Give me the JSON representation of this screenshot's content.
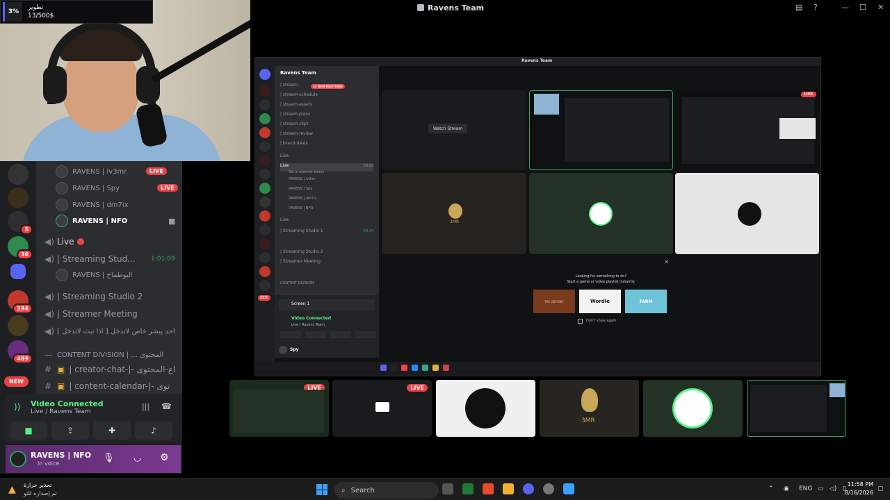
{
  "stream_goal": {
    "percent": "3%",
    "label": "تطوير",
    "progress": "13/500$"
  },
  "window": {
    "title": "Ravens Team"
  },
  "left_panel": {
    "voice_users_top": [
      {
        "name": "RAVENS | iv3mr",
        "live": "LIVE"
      },
      {
        "name": "RAVENS | Spy",
        "live": "LIVE"
      },
      {
        "name": "RAVENS | dm7ix"
      },
      {
        "name": "RAVENS | NFO"
      }
    ],
    "channel_live": "Live",
    "streaming_studio_1": "| Streaming Stud...",
    "studio_timer": "1:01:09",
    "studio_user": "RAVENS | البوطماح",
    "streaming_studio_2": "| Streaming Studio 2",
    "streamer_meeting": "| Streamer Meeting",
    "arabic_channel": "احد يبشر خاص لاتدخل [ اذا تبث لاتدخل ]",
    "category": "CONTENT DIVISION | ... المحتوى",
    "text_channels": [
      "| creator-chat-|- اع-المحتوى",
      "| content-calendar-|- توى"
    ],
    "server_badges": [
      "3",
      "36",
      "194",
      "489"
    ],
    "new_badge": "NEW"
  },
  "voice_connected": {
    "title": "Video Connected",
    "channel": "Live",
    "server": "/ Ravens Team"
  },
  "user_bar": {
    "name": "RAVENS | NFO",
    "status": "In voice"
  },
  "inner_discord": {
    "title": "Ravens Team",
    "server_name": "Ravens Team",
    "mentions": "21 NEW MENTIONS",
    "channels": [
      "| stream-",
      "| stream-schedule",
      "| stream-assets",
      "| stream-plans",
      "| stream-clips",
      "| stream-review",
      "| brand-deals"
    ],
    "live": "Live",
    "live_time": "59:00",
    "set_status": "Set a channel status",
    "voice_users": [
      "RAVENS | iv3mr",
      "RAVENS | Spy",
      "RAVENS | dm7ix",
      "RAVENS | NFO"
    ],
    "live2": "Live",
    "studio1": "| Streaming Studio 1",
    "studio1_time": "59:34",
    "studio2": "| Streaming Studio 2",
    "meeting": "| Streamer Meeting",
    "category": "CONTENT DIVISION",
    "screen": "Screen 1",
    "video_connected": "Video Connected",
    "vc_sub": "Live / Ravens Team",
    "user": "Spy",
    "watch_stream": "Watch Stream",
    "activity_title": "Looking for something to do?",
    "activity_sub": "Start a game or video playlist instantly.",
    "activities": [
      "THE ODYSSEY",
      "Wordle",
      "FARM"
    ],
    "dont_show": "Don't show again",
    "tile_label": "3MR"
  },
  "thumbs": [
    {
      "live": "LIVE"
    },
    {
      "live": "LIVE"
    },
    {},
    {
      "label": "3MR"
    },
    {},
    {}
  ],
  "taskbar": {
    "weather_title": "تحذير حرارة",
    "weather_sub": "تم إصداره للتو",
    "search": "Search",
    "lang": "ENG",
    "time": "11:58 PM",
    "date": "8/16/2026"
  }
}
